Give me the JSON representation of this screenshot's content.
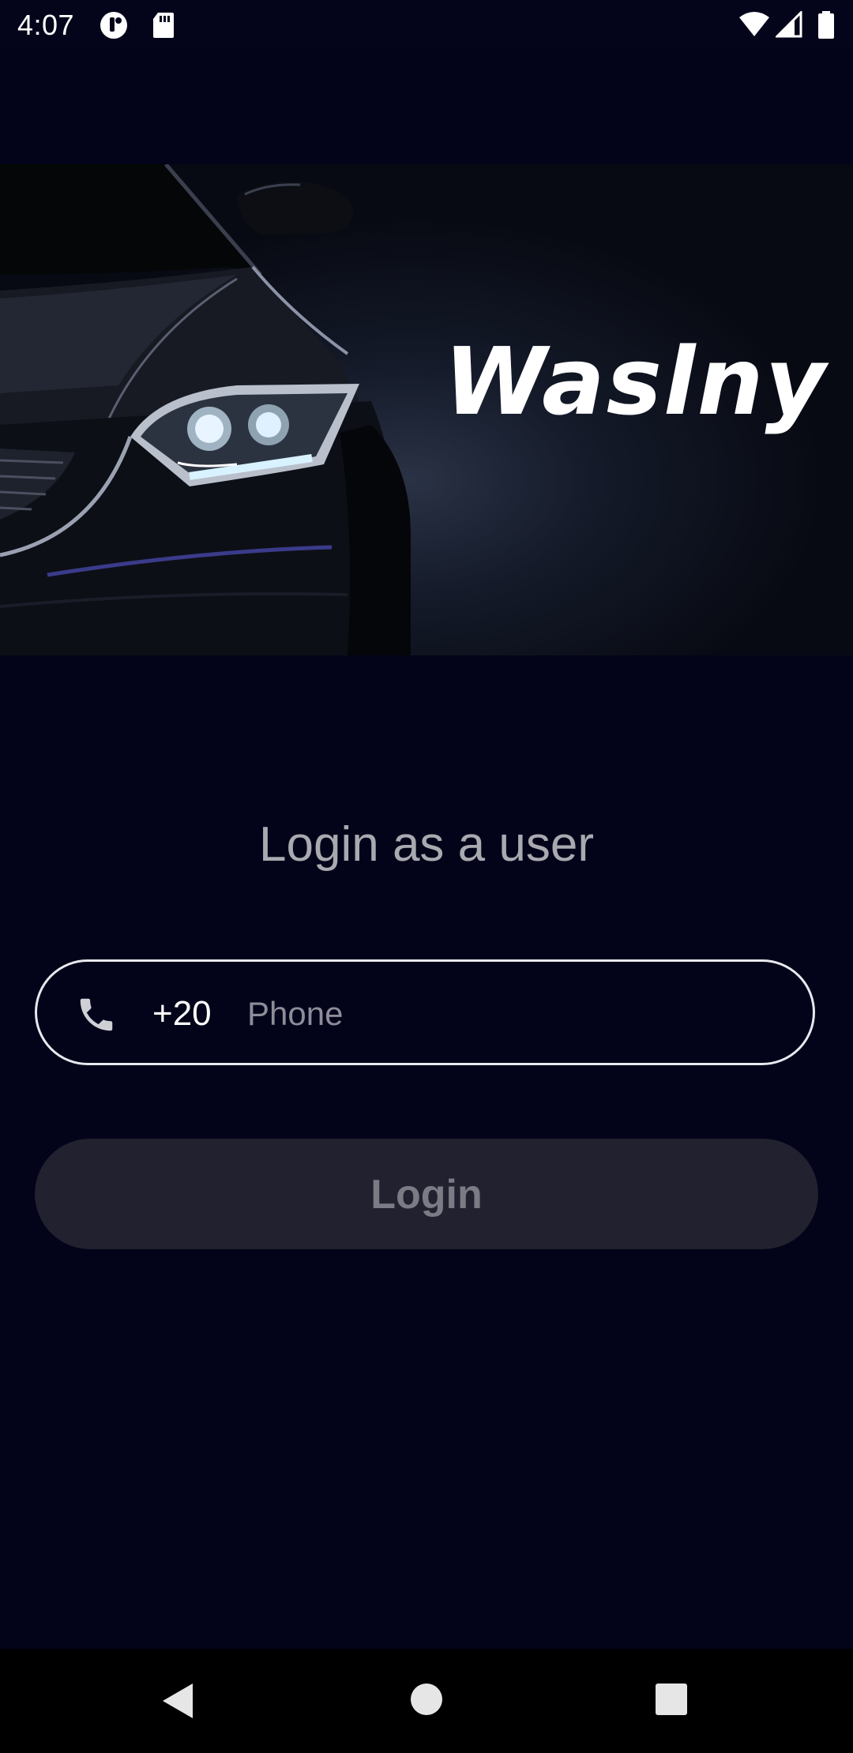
{
  "status_bar": {
    "time": "4:07",
    "icons": [
      "notification-icon",
      "sd-card-icon",
      "wifi-icon",
      "cell-signal-icon",
      "battery-icon"
    ]
  },
  "hero": {
    "brand": "Waslny",
    "image": "car-headlight-illustration"
  },
  "login": {
    "heading": "Login as a user",
    "country_code": "+20",
    "phone_placeholder": "Phone",
    "phone_value": "",
    "button_label": "Login"
  },
  "nav_bar": {
    "buttons": [
      "back-icon",
      "home-icon",
      "recents-icon"
    ]
  },
  "colors": {
    "background": "#03031a",
    "button_disabled_bg": "#21212f",
    "button_disabled_text": "#7b7b86",
    "heading_text": "#a9a9b0",
    "field_border": "#e8e8ee"
  }
}
